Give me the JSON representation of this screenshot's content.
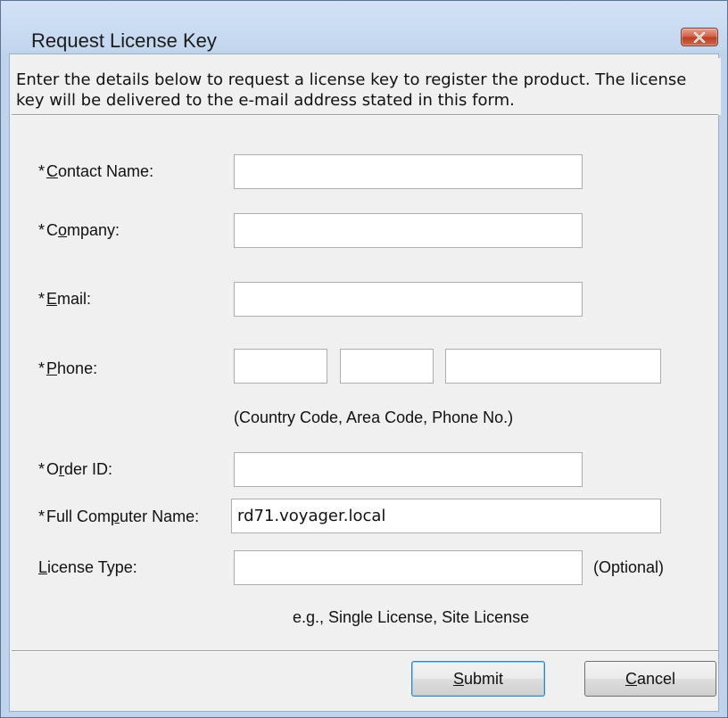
{
  "window": {
    "title": "Request License Key",
    "close_icon": "close-icon"
  },
  "intro": "Enter the details below to request a license key to register the product. The license key will be delivered to the e-mail address stated in this form.",
  "form": {
    "required_marker": "*",
    "contact_name": {
      "label_pre": "",
      "label_key": "C",
      "label_post": "ontact Name:",
      "value": ""
    },
    "company": {
      "label_pre": "C",
      "label_key": "o",
      "label_post": "mpany:",
      "value": ""
    },
    "email": {
      "label_pre": "",
      "label_key": "E",
      "label_post": "mail:",
      "value": ""
    },
    "phone": {
      "label_pre": "",
      "label_key": "P",
      "label_post": "hone:",
      "country_code": "",
      "area_code": "",
      "number": "",
      "hint": "(Country Code, Area Code, Phone No.)"
    },
    "order_id": {
      "label_pre": "O",
      "label_key": "r",
      "label_post": "der ID:",
      "value": ""
    },
    "computer_name": {
      "label_pre": "Full Com",
      "label_key": "p",
      "label_post": "uter Name:",
      "value": "rd71.voyager.local"
    },
    "license_type": {
      "label_pre": "",
      "label_key": "L",
      "label_post": "icense Type:",
      "value": "",
      "optional": "(Optional)",
      "hint": "e.g., Single License, Site License"
    }
  },
  "buttons": {
    "submit": {
      "pre": "",
      "key": "S",
      "post": "ubmit"
    },
    "cancel": {
      "pre": "",
      "key": "C",
      "post": "ancel"
    }
  }
}
